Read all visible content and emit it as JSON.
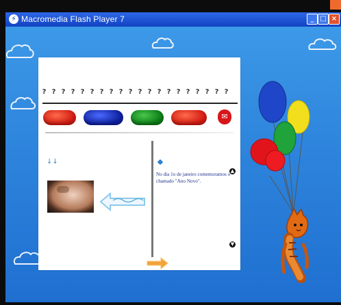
{
  "window": {
    "title": "Macromedia Flash Player 7",
    "buttons": {
      "minimize": "_",
      "maximize": "□",
      "close": "×"
    }
  },
  "page": {
    "small_left_mark": "↓↓",
    "text": "No dia 1o de janeiro comemoramos o chamado \"Ano Novo\".",
    "pins_count_label": "?"
  },
  "colors": {
    "title": "#1f56d6",
    "red": "#d01a12",
    "blue": "#0e1f9d",
    "green": "#0c7a17",
    "paper": "#ffffff"
  },
  "icons": {
    "flash": "flash-icon",
    "mail": "mail-icon",
    "scroll_up": "scroll-up-icon",
    "scroll_down": "scroll-down-icon",
    "back_arrow": "back-arrow-icon",
    "next_arrow": "next-arrow-icon"
  }
}
